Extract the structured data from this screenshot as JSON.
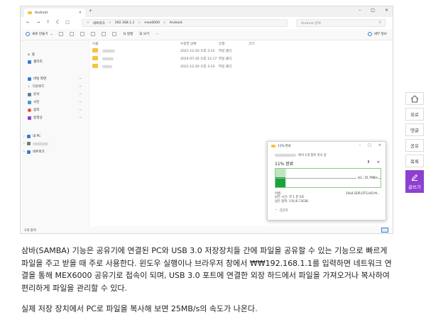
{
  "window": {
    "tab_title": "Android",
    "tab_close": "×",
    "tab_plus": "+",
    "controls": [
      "–",
      "□",
      "×"
    ]
  },
  "address": {
    "nav": [
      "←",
      "→",
      "↑",
      "C",
      "□"
    ],
    "segments": [
      "네트워크",
      "192.168.1.1",
      "mex6000",
      "Android"
    ],
    "separator": ">",
    "search_placeholder": "Android 검색",
    "search_icon": "search-icon"
  },
  "toolbar": {
    "new_label": "새로 만들기",
    "new_arrow": "⌄",
    "sort_label": "정렬",
    "view_label": "보기",
    "more": "···",
    "details_label": "세부 정보"
  },
  "sidebar": {
    "home": "홈",
    "gallery": "갤러리",
    "quick": [
      "바탕 화면",
      "다운로드",
      "문서",
      "사진",
      "음악",
      "동영상"
    ],
    "this_pc": "내 PC",
    "network": "네트워크",
    "pin_icon": "pin-icon"
  },
  "list": {
    "headers": [
      "이름",
      "수정한 날짜",
      "유형",
      "크기"
    ],
    "rows": [
      {
        "date": "2021-12-20 오후 3:33",
        "type": "파일 폴더"
      },
      {
        "date": "2024-07-26 오후 12:17",
        "type": "파일 폴더"
      },
      {
        "date": "2021-12-20 오후 3:33",
        "type": "파일 폴더"
      }
    ]
  },
  "status": {
    "count": "3개 항목"
  },
  "dialog": {
    "title": "11% 완료",
    "line1_suffix": "에서 1개 항목 복사 중",
    "percent": "11% 완료",
    "pause": "Ⅱ",
    "close": "×",
    "speed": "속도: 25.7MB/s",
    "progress_fraction": 0.11,
    "name_label": "이름:",
    "name_value": "19x8.SDR.DTS-HD.M...",
    "remaining_label": "남은 시간: 약 1 분 0초",
    "remaining_items": "남은 항목: 1개 (6.73GB)",
    "less_label": "간단히",
    "controls": [
      "–",
      "□",
      "×"
    ]
  },
  "side_buttons": {
    "b1": "위로",
    "b2": "댓글",
    "b3": "공유",
    "b4": "목록",
    "write": "글쓰기"
  },
  "article": {
    "p1": "삼바(SAMBA) 기능은 공유기에 연결된 PC와 USB 3.0 저장장치들 간에 파일을 공유할 수 있는 기능으로 빠르게 파일을 주고 받을 때 주로 사용한다. 윈도우 실행이나 브라우저 창에서 ₩₩192.168.1.1를 입력하면 네트워크 연결을 통해 MEX6000 공유기로 접속이 되며, USB 3.0 포트에 연결한 외장 하드에서 파일을 가져오거나 복사하여 편리하게 파일을 관리할 수 있다.",
    "p2": "실제 저장 장치에서 PC로 파일을 복사해 보면 25MB/s의 속도가 나온다."
  },
  "colors": {
    "accent": "#3a7bd5",
    "folder": "#f5c242",
    "progress": "#1aa33a",
    "write_button": "#8e3fd0"
  }
}
